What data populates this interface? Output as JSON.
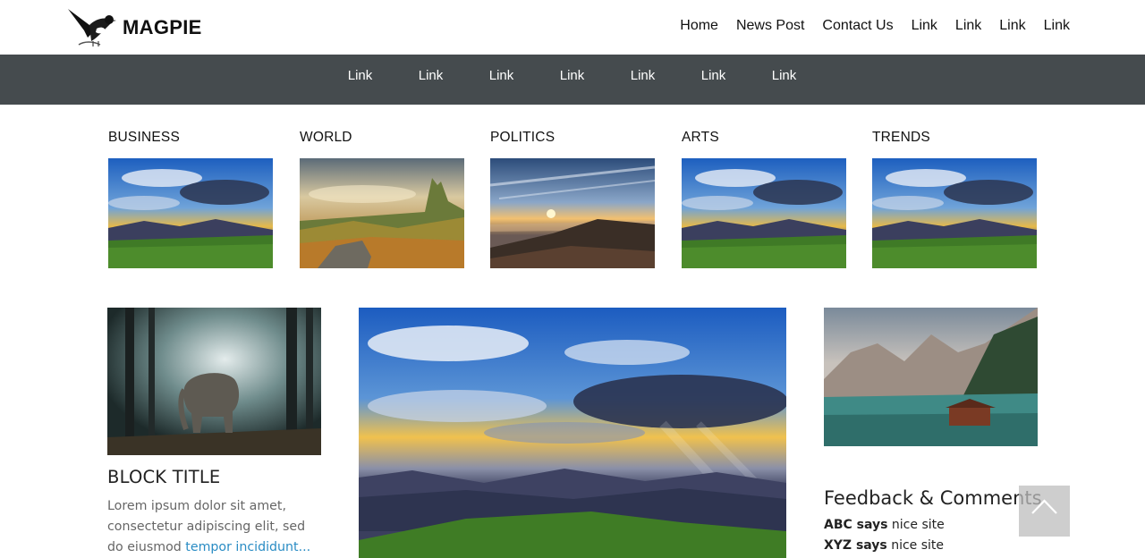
{
  "brand": {
    "name": "MAGPIE"
  },
  "top_nav": [
    "Home",
    "News Post",
    "Contact Us",
    "Link",
    "Link",
    "Link",
    "Link"
  ],
  "sub_nav": [
    "Link",
    "Link",
    "Link",
    "Link",
    "Link",
    "Link",
    "Link"
  ],
  "categories": [
    "BUSINESS",
    "WORLD",
    "POLITICS",
    "ARTS",
    "TRENDS"
  ],
  "block": {
    "title": "BLOCK TITLE",
    "text": "Lorem ipsum dolor sit amet, consectetur adipiscing elit, sed do eiusmod",
    "more_link": "tempor incididunt..."
  },
  "feedback": {
    "title": "Feedback & Comments",
    "comments": [
      {
        "author": "ABC says",
        "text": "nice site"
      },
      {
        "author": "XYZ says",
        "text": "nice site"
      }
    ]
  },
  "colors": {
    "subnav_bg": "#454b4e",
    "link_accent": "#2a8cc4"
  },
  "icons": {
    "logo": "magpie-bird-icon",
    "scroll_top": "chevron-up-icon"
  }
}
